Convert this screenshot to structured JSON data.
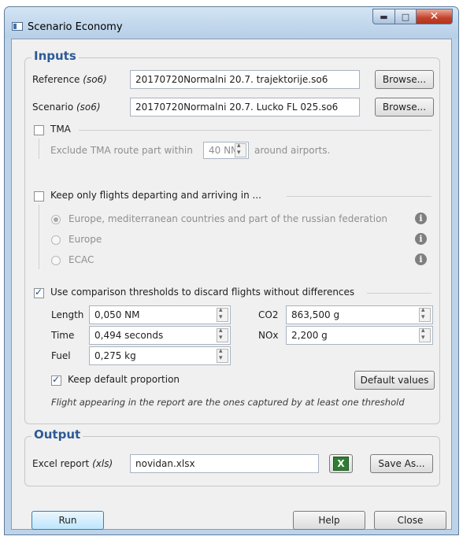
{
  "window": {
    "title": "Scenario Economy",
    "minimize_icon": "minimize-icon",
    "maximize_icon": "maximize-icon",
    "close_icon": "close-icon"
  },
  "inputs": {
    "legend": "Inputs",
    "reference": {
      "label": "Reference",
      "format": "(so6)",
      "value": "20170720Normalni 20.7. trajektorije.so6",
      "button": "Browse..."
    },
    "scenario": {
      "label": "Scenario",
      "format": "(so6)",
      "value": "20170720Normalni 20.7. Lucko FL 025.so6",
      "button": "Browse..."
    },
    "tma": {
      "label": "TMA",
      "checked": false,
      "exclude_prefix": "Exclude TMA route part within",
      "distance": "40 NM",
      "exclude_suffix": "around airports."
    },
    "keep_flights": {
      "label": "Keep only flights departing and arriving in ...",
      "checked": false,
      "options": [
        {
          "label": "Europe, mediterranean countries and part of the russian federation",
          "selected": true,
          "icon": "info-icon"
        },
        {
          "label": "Europe",
          "selected": false,
          "icon": "info-icon"
        },
        {
          "label": "ECAC",
          "selected": false,
          "icon": "info-icon"
        }
      ]
    },
    "thresholds": {
      "label": "Use comparison thresholds to discard flights without differences",
      "checked": true,
      "length": {
        "label": "Length",
        "value": "0,050 NM"
      },
      "time": {
        "label": "Time",
        "value": "0,494 seconds"
      },
      "fuel": {
        "label": "Fuel",
        "value": "0,275 kg"
      },
      "co2": {
        "label": "CO2",
        "value": "863,500 g"
      },
      "nox": {
        "label": "NOx",
        "value": "2,200 g"
      },
      "keep_default": {
        "label": "Keep default proportion",
        "checked": true
      },
      "default_button": "Default values",
      "note": "Flight appearing in the report are the ones captured by at least one threshold"
    }
  },
  "output": {
    "legend": "Output",
    "excel": {
      "label": "Excel report",
      "format": "(xls)",
      "value": "novidan.xlsx",
      "icon": "excel-icon",
      "icon_glyph": "X",
      "button": "Save As..."
    }
  },
  "footer": {
    "run": "Run",
    "help": "Help",
    "close": "Close"
  }
}
